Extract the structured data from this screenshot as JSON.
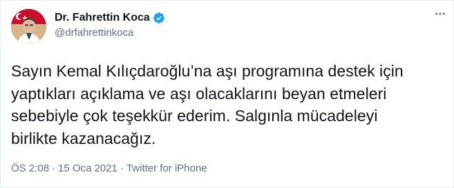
{
  "tweet": {
    "author": {
      "display_name": "Dr. Fahrettin Koca",
      "handle": "@drfahrettinkoca",
      "verified": true,
      "avatar_icon": "profile-photo"
    },
    "more_icon": "more-horizontal-icon",
    "text": "Sayın Kemal Kılıçdaroğlu’na aşı programına destek için\nyaptıkları açıklama ve aşı olacaklarını beyan etmeleri\nsebebiyle çok teşekkür ederim. Salgınla mücadeleyi\nbirlikte kazanacağız.",
    "time": "ÖS 2:08",
    "separator": "·",
    "date": "15 Oca 2021",
    "source": "Twitter for iPhone"
  },
  "colors": {
    "verified_blue": "#1da1f2",
    "secondary_text": "#5b7083",
    "primary_text": "#0f1419",
    "border": "#e6ecf0"
  }
}
